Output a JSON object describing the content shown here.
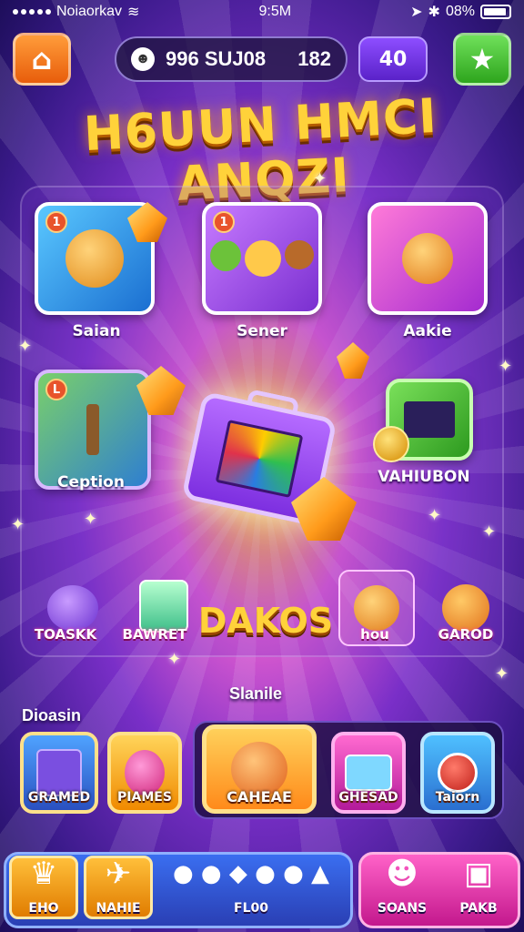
{
  "status_bar": {
    "carrier": "Noiaorkav",
    "time": "9:5M",
    "battery": "08%"
  },
  "top_bar": {
    "currency_label": "996 SUJ08",
    "currency_count": "182",
    "gem_count": "40"
  },
  "game_title": "H6UUN HMCI ANQZI",
  "tiles": [
    {
      "label": "Saian",
      "badge": "1"
    },
    {
      "label": "Sener",
      "badge": "1"
    },
    {
      "label": "Aakie",
      "badge": ""
    },
    {
      "label": "Ception",
      "badge": "L"
    },
    {
      "label": "VAHIUBON",
      "badge": ""
    }
  ],
  "row_items": [
    {
      "label": "TOASKK"
    },
    {
      "label": "BAWRET"
    },
    {
      "label": "hou"
    },
    {
      "label": "GAROD"
    }
  ],
  "promo_text": "DAKOS",
  "section_labels": {
    "left": "Dioasin",
    "center": "Slanile"
  },
  "cards": [
    {
      "label": "GRAMED"
    },
    {
      "label": "PIAMES"
    },
    {
      "label": "CAHEAE"
    },
    {
      "label": "GHESAD"
    },
    {
      "label": "Taiorn"
    }
  ],
  "nav": {
    "items": [
      {
        "label": "EHO",
        "icon": "crown-icon"
      },
      {
        "label": "NAHIE",
        "icon": "bird-icon"
      },
      {
        "label": "FL00",
        "icon": "creatures-icon"
      },
      {
        "label": "SOANS",
        "icon": "bear-icon"
      },
      {
        "label": "PAKB",
        "icon": "box-icon"
      }
    ]
  },
  "colors": {
    "accent_orange": "#ff9c3a",
    "accent_green": "#2ea51d",
    "accent_purple": "#7d2fe0",
    "title_gold": "#ffd23a"
  }
}
